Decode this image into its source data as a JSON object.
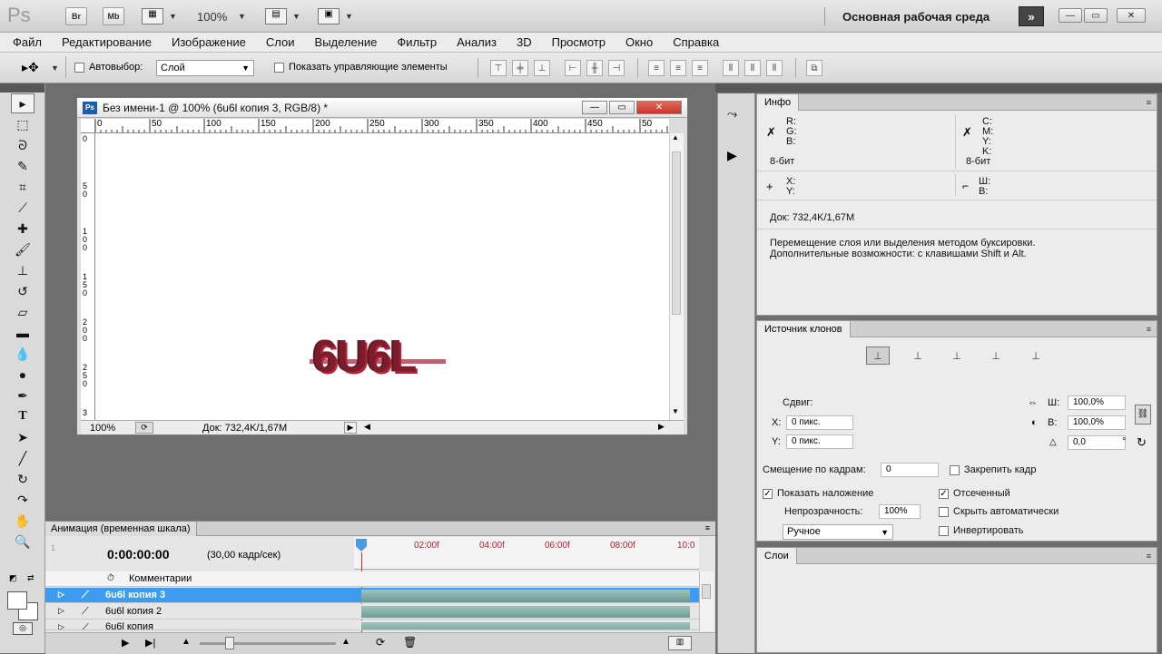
{
  "titlebar": {
    "app_logo": "Ps",
    "btn_br": "Br",
    "btn_mb": "Mb",
    "zoom": "100%",
    "workspace": "Основная рабочая среда",
    "more": "»"
  },
  "menu": [
    "Файл",
    "Редактирование",
    "Изображение",
    "Слои",
    "Выделение",
    "Фильтр",
    "Анализ",
    "3D",
    "Просмотр",
    "Окно",
    "Справка"
  ],
  "options": {
    "autoselect_label": "Автовыбор:",
    "autoselect_value": "Слой",
    "show_controls_label": "Показать управляющие элементы"
  },
  "document": {
    "title": "Без имени-1 @ 100% (6u6l копия 3, RGB/8) *",
    "ruler_h": [
      "0",
      "50",
      "100",
      "150",
      "200",
      "250",
      "300",
      "350",
      "400",
      "450",
      "50"
    ],
    "ruler_v": [
      "0",
      "5\n0",
      "1\n0\n0",
      "1\n5\n0",
      "2\n0\n0",
      "2\n5\n0",
      "3"
    ],
    "zoom": "100%",
    "doc_size": "Док: 732,4K/1,67M",
    "canvas_text": "6U6L"
  },
  "animation": {
    "tab": "Анимация (временная шкала)",
    "timecode": "0:00:00:00",
    "fps": "(30,00 кадр/сек)",
    "ticks": [
      "02:00f",
      "04:00f",
      "06:00f",
      "08:00f",
      "10:0"
    ],
    "comments_label": "Комментарии",
    "layers": [
      "6u6l копия 3",
      "6u6l копия 2",
      "6u6l копия"
    ]
  },
  "info": {
    "tab": "Инфо",
    "r": "R:",
    "g": "G:",
    "b": "B:",
    "c": "C:",
    "m": "M:",
    "y": "Y:",
    "k": "K:",
    "bits_left": "8-бит",
    "bits_right": "8-бит",
    "x": "X:",
    "yy": "Y:",
    "w": "Ш:",
    "h": "В:",
    "doc_size": "Док: 732,4K/1,67M",
    "hint1": "Перемещение слоя или выделения методом буксировки.",
    "hint2": "Дополнительные возможности: с клавишами Shift и Alt."
  },
  "clone": {
    "tab": "Источник клонов",
    "offset_label": "Сдвиг:",
    "x_label": "X:",
    "x_value": "0 пикс.",
    "y_label": "Y:",
    "y_value": "0 пикс.",
    "w_label": "Ш:",
    "w_value": "100,0%",
    "h_label": "В:",
    "h_value": "100,0%",
    "angle_value": "0,0",
    "angle_unit": "°",
    "frame_offset_label": "Смещение по кадрам:",
    "frame_offset_value": "0",
    "lock_frame": "Закрепить кадр",
    "show_overlay": "Показать наложение",
    "clipped": "Отсеченный",
    "opacity_label": "Непрозрачность:",
    "opacity_value": "100%",
    "auto_hide": "Скрыть автоматически",
    "mode": "Ручное",
    "invert": "Инвертировать"
  },
  "layers_panel": {
    "tab": "Слои"
  },
  "colors": {
    "accent_blue": "#3d9cf0",
    "logo_red": "#7b1d2a",
    "timeline_bar": "#7fa9a1"
  }
}
